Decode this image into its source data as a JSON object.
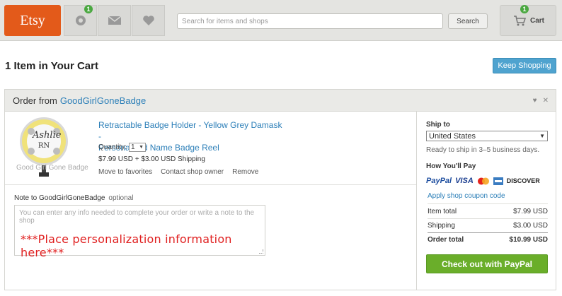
{
  "header": {
    "logo": "Etsy",
    "activity_badge": "1",
    "cart_badge": "1",
    "search_placeholder": "Search for items and shops",
    "search_button": "Search",
    "cart_label": "Cart"
  },
  "page": {
    "title": "1 Item in Your Cart",
    "keep_shopping": "Keep Shopping"
  },
  "order": {
    "from_label": "Order from",
    "shop_name": "GoodGirlGoneBadge",
    "item": {
      "thumb_caption": "Good Girl Gone Badge",
      "thumb_name": "Ashlie",
      "thumb_title": "RN",
      "title_line1": "Retractable Badge Holder - Yellow Grey Damask -",
      "title_line2": "Personalized Name Badge Reel",
      "quantity_label": "Quantity:",
      "quantity_value": "1",
      "price": "$7.99 USD + $3.00 USD Shipping",
      "actions": [
        "Move to favorites",
        "Contact shop owner",
        "Remove"
      ]
    },
    "note": {
      "label": "Note to GoodGirlGoneBadge",
      "optional": "optional",
      "placeholder": "You can enter any info needed to complete your order or write a note to the shop",
      "handwritten": "***Place personalization information here***"
    }
  },
  "summary": {
    "ship_to_label": "Ship to",
    "ship_to_value": "United States",
    "ready_text": "Ready to ship in 3–5 business days.",
    "pay_label": "How You'll Pay",
    "pay_methods": [
      "PayPal",
      "VISA",
      "DISCOVER"
    ],
    "coupon": "Apply shop coupon code",
    "item_total_label": "Item total",
    "item_total": "$7.99 USD",
    "shipping_label": "Shipping",
    "shipping": "$3.00 USD",
    "order_total_label": "Order total",
    "order_total": "$10.99 USD",
    "checkout": "Check out with PayPal"
  },
  "colors": {
    "brand": "#e35a1a",
    "link": "#2c7fb8",
    "checkout": "#6aae2a",
    "keep_shopping": "#4fa3cf"
  }
}
